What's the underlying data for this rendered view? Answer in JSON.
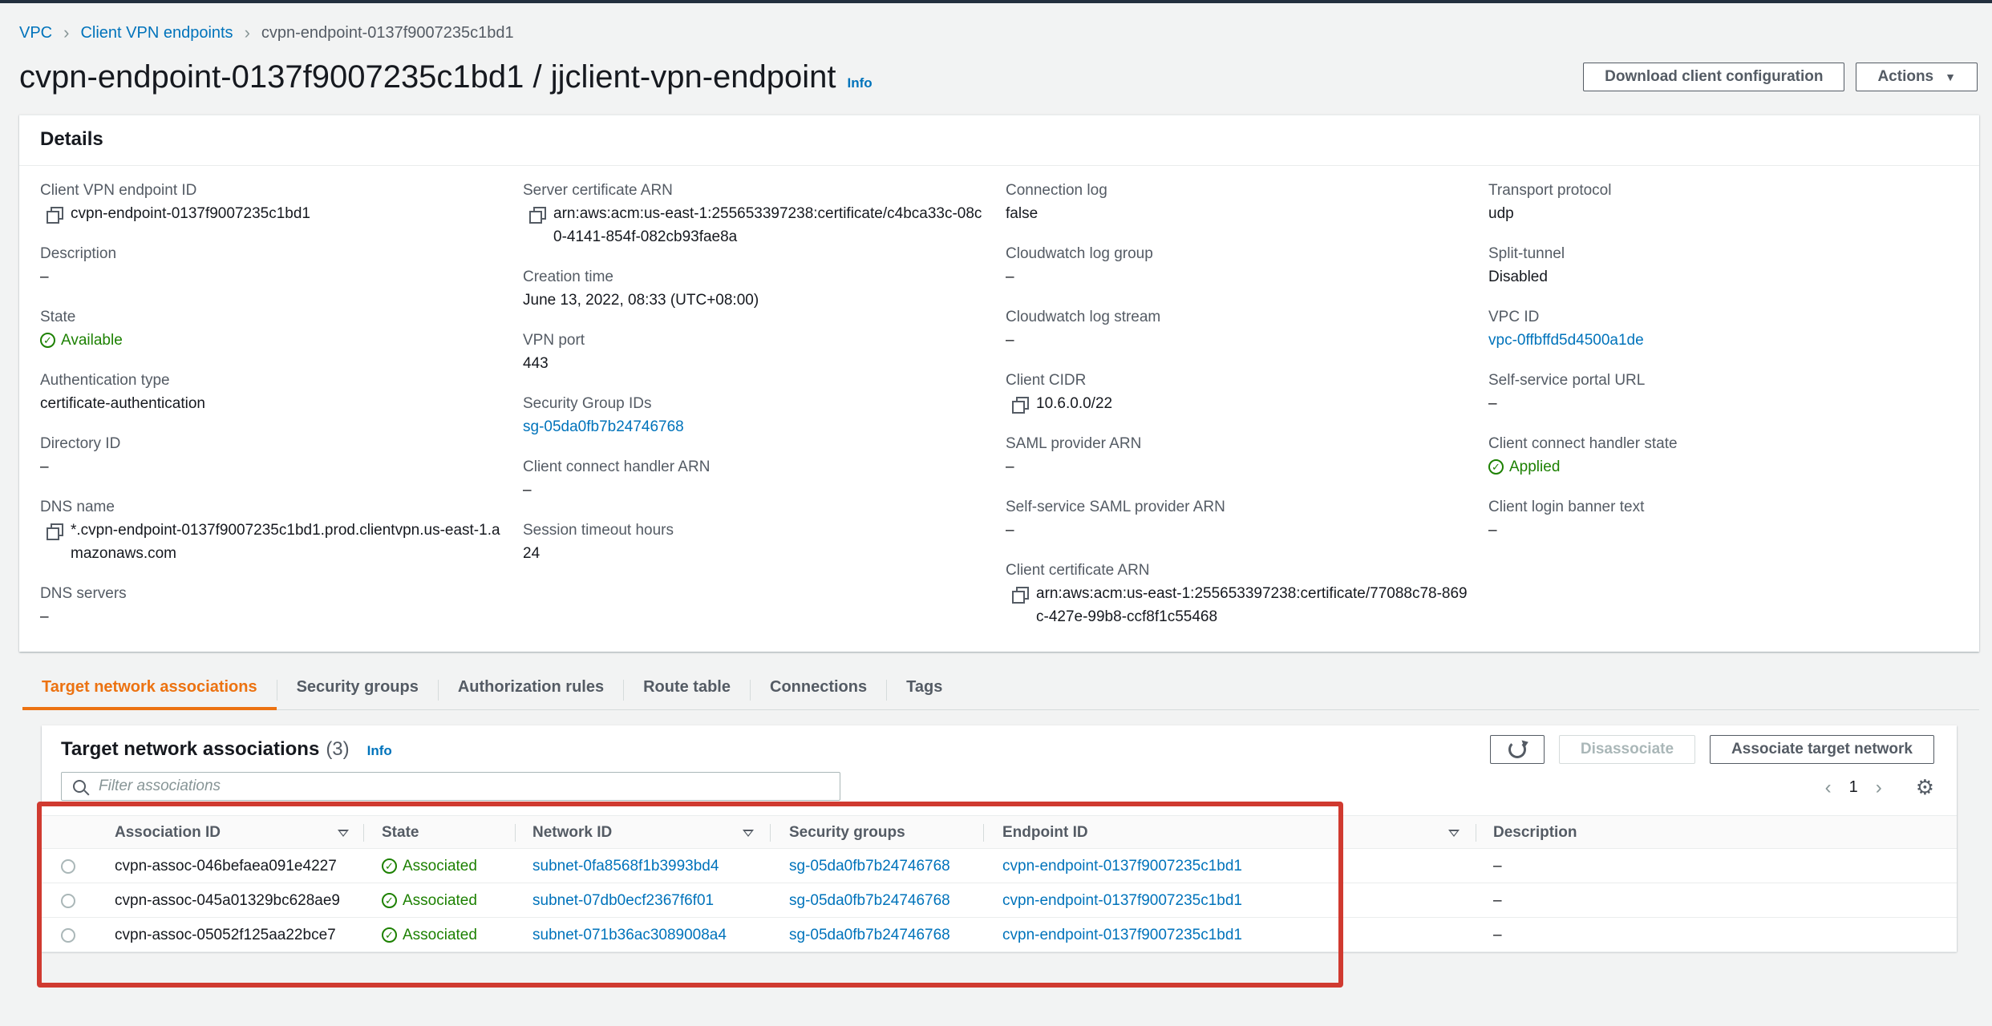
{
  "breadcrumb": {
    "items": [
      "VPC",
      "Client VPN endpoints"
    ],
    "current": "cvpn-endpoint-0137f9007235c1bd1"
  },
  "header": {
    "title": "cvpn-endpoint-0137f9007235c1bd1 / jjclient-vpn-endpoint",
    "info": "Info",
    "download_button": "Download client configuration",
    "actions_button": "Actions"
  },
  "details": {
    "title": "Details",
    "col1": [
      {
        "label": "Client VPN endpoint ID",
        "value": "cvpn-endpoint-0137f9007235c1bd1"
      },
      {
        "label": "Description",
        "value": "–"
      },
      {
        "label": "State",
        "value": "Available"
      },
      {
        "label": "Authentication type",
        "value": "certificate-authentication"
      },
      {
        "label": "Directory ID",
        "value": "–"
      },
      {
        "label": "DNS name",
        "value": "*.cvpn-endpoint-0137f9007235c1bd1.prod.clientvpn.us-east-1.amazonaws.com"
      },
      {
        "label": "DNS servers",
        "value": "–"
      }
    ],
    "col2": [
      {
        "label": "Server certificate ARN",
        "value": "arn:aws:acm:us-east-1:255653397238:certificate/c4bca33c-08c0-4141-854f-082cb93fae8a"
      },
      {
        "label": "Creation time",
        "value": "June 13, 2022, 08:33 (UTC+08:00)"
      },
      {
        "label": "VPN port",
        "value": "443"
      },
      {
        "label": "Security Group IDs",
        "value": "sg-05da0fb7b24746768"
      },
      {
        "label": "Client connect handler ARN",
        "value": "–"
      },
      {
        "label": "Session timeout hours",
        "value": "24"
      }
    ],
    "col3": [
      {
        "label": "Connection log",
        "value": "false"
      },
      {
        "label": "Cloudwatch log group",
        "value": "–"
      },
      {
        "label": "Cloudwatch log stream",
        "value": "–"
      },
      {
        "label": "Client CIDR",
        "value": "10.6.0.0/22"
      },
      {
        "label": "SAML provider ARN",
        "value": "–"
      },
      {
        "label": "Self-service SAML provider ARN",
        "value": "–"
      },
      {
        "label": "Client certificate ARN",
        "value": "arn:aws:acm:us-east-1:255653397238:certificate/77088c78-869c-427e-99b8-ccf8f1c55468"
      }
    ],
    "col4": [
      {
        "label": "Transport protocol",
        "value": "udp"
      },
      {
        "label": "Split-tunnel",
        "value": "Disabled"
      },
      {
        "label": "VPC ID",
        "value": "vpc-0ffbffd5d4500a1de"
      },
      {
        "label": "Self-service portal URL",
        "value": "–"
      },
      {
        "label": "Client connect handler state",
        "value": "Applied"
      },
      {
        "label": "Client login banner text",
        "value": "–"
      }
    ]
  },
  "tabs": [
    "Target network associations",
    "Security groups",
    "Authorization rules",
    "Route table",
    "Connections",
    "Tags"
  ],
  "associations": {
    "title": "Target network associations",
    "count": "(3)",
    "info": "Info",
    "disassociate_button": "Disassociate",
    "associate_button": "Associate target network",
    "filter_placeholder": "Filter associations",
    "page": "1",
    "columns": [
      "Association ID",
      "State",
      "Network ID",
      "Security groups",
      "Endpoint ID",
      "Description"
    ],
    "rows": [
      {
        "id": "cvpn-assoc-046befaea091e4227",
        "state": "Associated",
        "network": "subnet-0fa8568f1b3993bd4",
        "sg": "sg-05da0fb7b24746768",
        "endpoint": "cvpn-endpoint-0137f9007235c1bd1",
        "description": "–"
      },
      {
        "id": "cvpn-assoc-045a01329bc628ae9",
        "state": "Associated",
        "network": "subnet-07db0ecf2367f6f01",
        "sg": "sg-05da0fb7b24746768",
        "endpoint": "cvpn-endpoint-0137f9007235c1bd1",
        "description": "–"
      },
      {
        "id": "cvpn-assoc-05052f125aa22bce7",
        "state": "Associated",
        "network": "subnet-071b36ac3089008a4",
        "sg": "sg-05da0fb7b24746768",
        "endpoint": "cvpn-endpoint-0137f9007235c1bd1",
        "description": "–"
      }
    ]
  },
  "colors": {
    "link": "#0073bb",
    "success": "#1d8102",
    "active_tab": "#ec7211",
    "highlight": "#d03a30"
  }
}
